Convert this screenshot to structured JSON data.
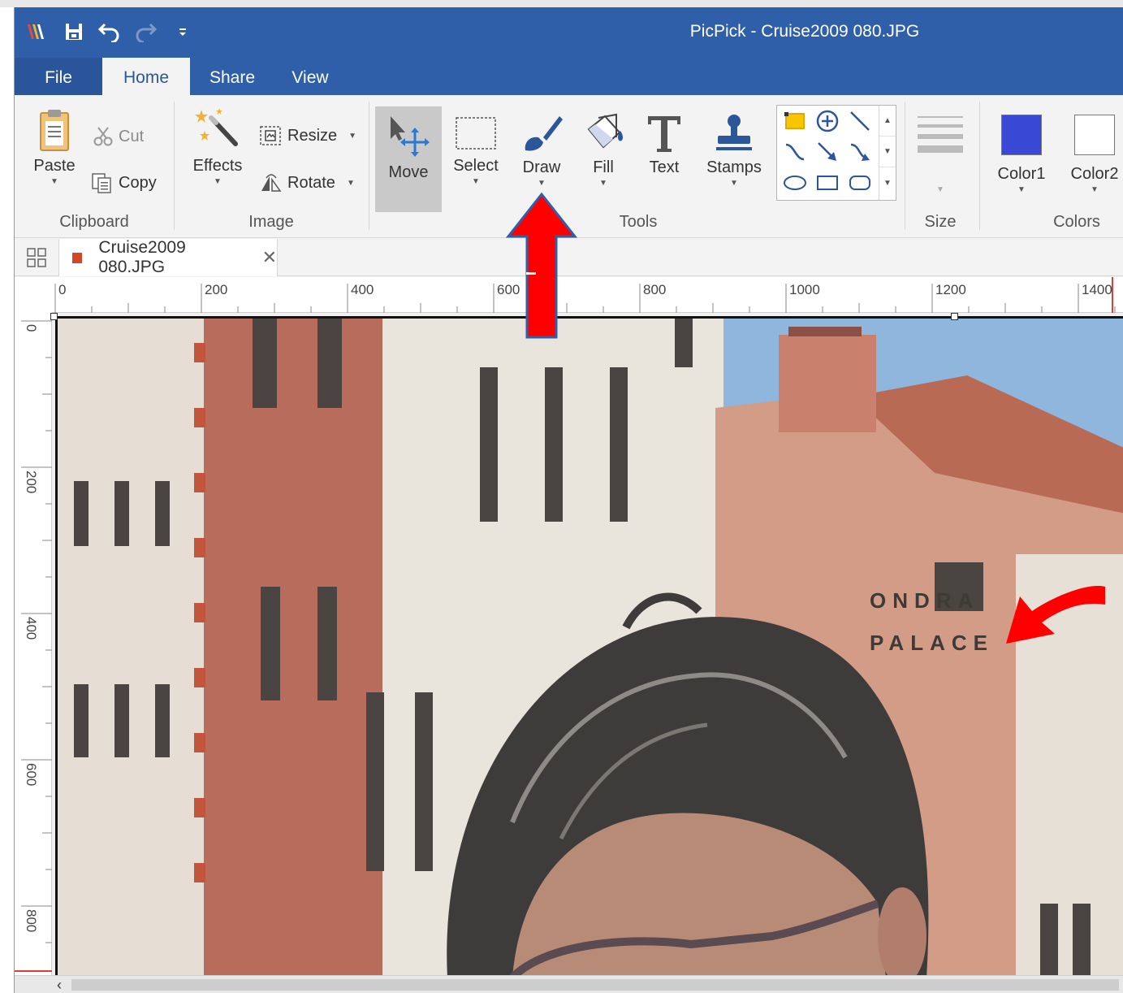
{
  "window": {
    "title": "PicPick - Cruise2009 080.JPG"
  },
  "menu": {
    "file": "File",
    "tabs": [
      "Home",
      "Share",
      "View"
    ],
    "active_tab": "Home"
  },
  "ribbon": {
    "clipboard": {
      "group_label": "Clipboard",
      "paste": "Paste",
      "cut": "Cut",
      "copy": "Copy"
    },
    "image": {
      "group_label": "Image",
      "effects": "Effects",
      "resize": "Resize",
      "rotate": "Rotate"
    },
    "tools": {
      "group_label": "Tools",
      "move": "Move",
      "select": "Select",
      "draw": "Draw",
      "fill": "Fill",
      "text": "Text",
      "stamps": "Stamps",
      "shape_icons": [
        "rectangle-select-icon",
        "add-circle-icon",
        "line-icon",
        "curve-icon",
        "arrow-icon",
        "curved-arrow-icon",
        "ellipse-icon",
        "rectangle-icon",
        "rounded-rectangle-icon"
      ]
    },
    "size": {
      "group_label": "Size"
    },
    "colors": {
      "group_label": "Colors",
      "color1": "Color1",
      "color2": "Color2",
      "color1_value": "#3a48d6",
      "color2_value": "#ffffff"
    }
  },
  "document": {
    "tab_name": "Cruise2009 080.JPG"
  },
  "rulers": {
    "horizontal": [
      "0",
      "200",
      "400",
      "600",
      "800",
      "1000",
      "1200",
      "1400"
    ],
    "vertical": [
      "0",
      "200",
      "400",
      "600",
      "800"
    ]
  },
  "photo_sign_text": [
    "ONDRA",
    "PALACE"
  ],
  "annotations": {
    "arrow_color": "#ff0000"
  },
  "colors": {
    "titlebar": "#2e5fa8",
    "accent_text": "#2b579a"
  }
}
